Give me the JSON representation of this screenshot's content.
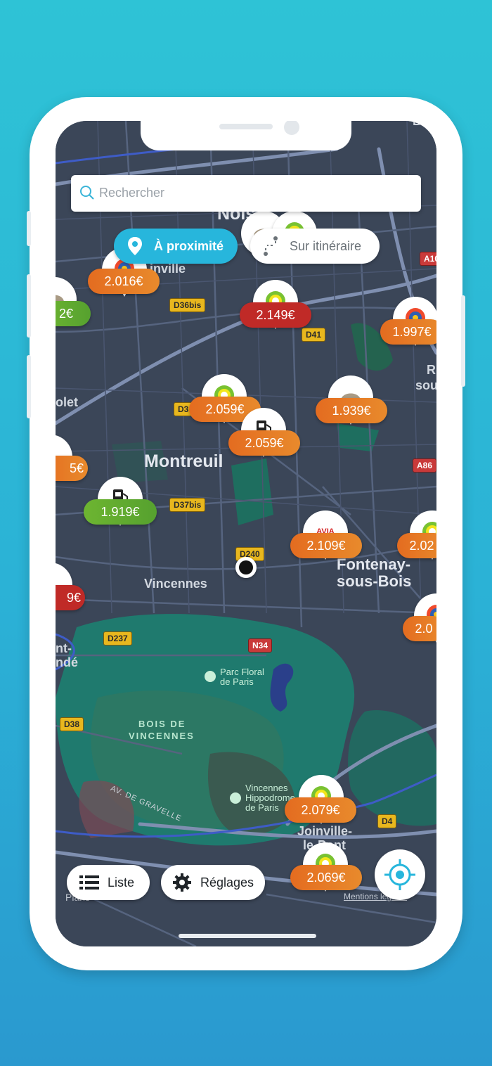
{
  "search": {
    "placeholder": "Rechercher"
  },
  "mode_toggle": {
    "nearby_label": "À proximité",
    "route_label": "Sur itinéraire"
  },
  "bottom_bar": {
    "list_label": "Liste",
    "settings_label": "Réglages",
    "legal_label": "Mentions légales",
    "maps_label": "Plans"
  },
  "map_labels": {
    "montreuil": "Montreuil",
    "vincennes": "Vincennes",
    "fontenay": "Fontenay-\nsous-Bois",
    "fontenay_l1": "Fontenay-",
    "fontenay_l2": "sous-Bois",
    "joinville_l1": "Joinville-",
    "joinville_l2": "le-Pont",
    "bois_l1": "BOIS DE",
    "bois_l2": "VINCENNES",
    "parc_l1": "Parc Floral",
    "parc_l2": "de Paris",
    "hippo_l1": "Vincennes",
    "hippo_l2": "Hippodrome",
    "hippo_l3": "de Paris",
    "bagnolet": "olet",
    "romainville": "inville",
    "noisy": "Nois",
    "ndé": "ndé",
    "nt": "nt-",
    "avenue": "AV. DE GRAVELLE",
    "rosny_r": "R",
    "rosny_sou": "sou",
    "bo": "Bo"
  },
  "roads": {
    "d36bis": "D36bis",
    "d41": "D41",
    "d37bis": "D37bis",
    "d240": "D240",
    "d237": "D237",
    "n34": "N34",
    "d38": "D38",
    "d4": "D4",
    "a86": "A86",
    "a10": "A10",
    "d3": "D3"
  },
  "stations": [
    {
      "brand": "total",
      "price": "2.016€",
      "color": "orange"
    },
    {
      "brand": "shell",
      "price": "2€",
      "color": "green"
    },
    {
      "brand": "bp",
      "price": "2.149€",
      "color": "red"
    },
    {
      "brand": "total",
      "price": "1.997€",
      "color": "orange"
    },
    {
      "brand": "bp",
      "price": "2.059€",
      "color": "orange"
    },
    {
      "brand": "generic",
      "price": "2.059€",
      "color": "orange"
    },
    {
      "brand": "shell",
      "price": "1.939€",
      "color": "orange"
    },
    {
      "brand": "generic",
      "price": "1.919€",
      "color": "green"
    },
    {
      "brand": "avia",
      "price": "2.109€",
      "color": "orange"
    },
    {
      "brand": "bp",
      "price": "2.02",
      "color": "orange"
    },
    {
      "brand": "generic",
      "price": "5€",
      "color": "orange"
    },
    {
      "brand": "generic",
      "price": "9€",
      "color": "red"
    },
    {
      "brand": "total",
      "price": "2.0",
      "color": "orange"
    },
    {
      "brand": "bp",
      "price": "2.079€",
      "color": "orange"
    },
    {
      "brand": "bp",
      "price": "2.069€",
      "color": "orange"
    }
  ],
  "colors": {
    "accent": "#27b6dc",
    "map_bg": "#3b4658",
    "price_orange": "#e46c20",
    "price_green": "#6db531",
    "price_red": "#c02a27"
  }
}
